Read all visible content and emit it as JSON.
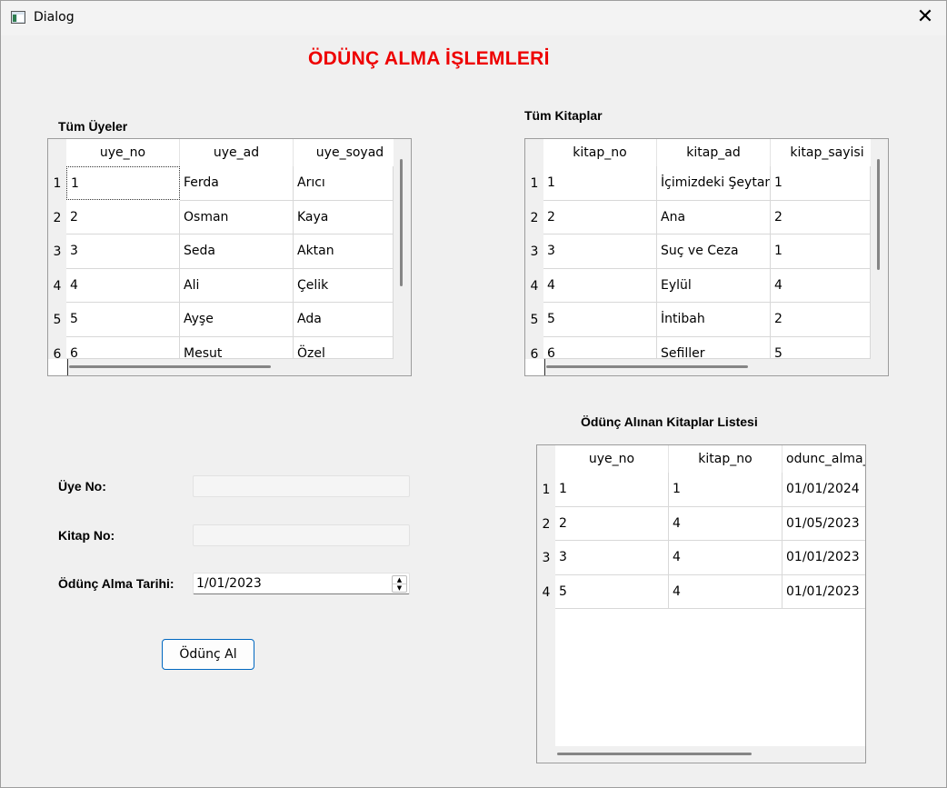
{
  "window": {
    "title": "Dialog",
    "close_symbol": "✕"
  },
  "page_title": "ÖDÜNÇ ALMA İŞLEMLERİ",
  "members": {
    "label": "Tüm Üyeler",
    "columns": [
      "uye_no",
      "uye_ad",
      "uye_soyad"
    ],
    "row_numbers": [
      "1",
      "2",
      "3",
      "4",
      "5",
      "6"
    ],
    "rows": [
      [
        "1",
        "Ferda",
        "Arıcı"
      ],
      [
        "2",
        "Osman",
        "Kaya"
      ],
      [
        "3",
        "Seda",
        "Aktan"
      ],
      [
        "4",
        "Ali",
        "Çelik"
      ],
      [
        "5",
        "Ayşe",
        "Ada"
      ],
      [
        "6",
        "Mesut",
        "Özel"
      ]
    ]
  },
  "books": {
    "label": "Tüm Kitaplar",
    "columns": [
      "kitap_no",
      "kitap_ad",
      "kitap_sayisi"
    ],
    "row_numbers": [
      "1",
      "2",
      "3",
      "4",
      "5",
      "6"
    ],
    "rows": [
      [
        "1",
        "İçimizdeki Şeytan",
        "1"
      ],
      [
        "2",
        "Ana",
        "2"
      ],
      [
        "3",
        "Suç ve Ceza",
        "1"
      ],
      [
        "4",
        "Eylül",
        "4"
      ],
      [
        "5",
        "İntibah",
        "2"
      ],
      [
        "6",
        "Sefiller",
        "5"
      ]
    ]
  },
  "loans": {
    "label": "Ödünç Alınan Kitaplar Listesi",
    "columns": [
      "uye_no",
      "kitap_no",
      "odunc_alma_t"
    ],
    "row_numbers": [
      "1",
      "2",
      "3",
      "4"
    ],
    "rows": [
      [
        "1",
        "1",
        "01/01/2024"
      ],
      [
        "2",
        "4",
        "01/05/2023"
      ],
      [
        "3",
        "4",
        "01/01/2023"
      ],
      [
        "5",
        "4",
        "01/01/2023"
      ]
    ]
  },
  "form": {
    "member_no_label": "Üye No:",
    "member_no_value": "",
    "book_no_label": "Kitap No:",
    "book_no_value": "",
    "date_label": "Ödünç Alma Tarihi:",
    "date_value": "1/01/2023",
    "submit_label": "Ödünç Al"
  }
}
